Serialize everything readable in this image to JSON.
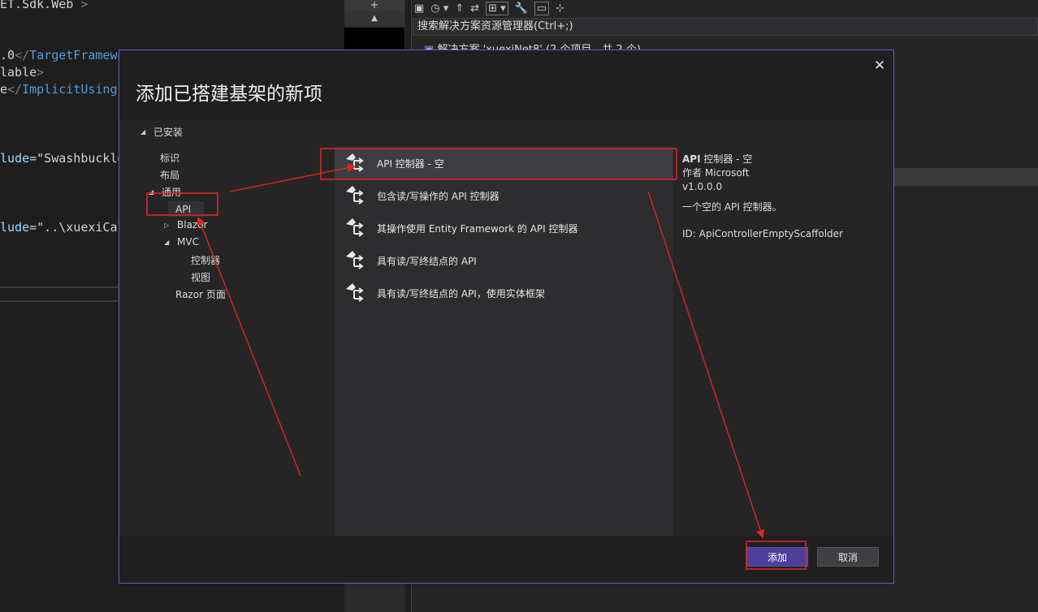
{
  "editor": {
    "lines": [
      {
        "prefix": "",
        "seg": [
          {
            "t": "ET.Sdk.Web",
            "c": "c-text"
          },
          {
            "t": " >",
            "c": "c-gray"
          }
        ]
      },
      {
        "prefix": "",
        "seg": [
          {
            "t": ".0",
            "c": "c-text"
          },
          {
            "t": "</",
            "c": "c-gray"
          },
          {
            "t": "TargetFramewo",
            "c": "c-blue"
          }
        ]
      },
      {
        "prefix": "",
        "seg": [
          {
            "t": "lable",
            "c": "c-text"
          },
          {
            "t": ">",
            "c": "c-gray"
          }
        ]
      },
      {
        "prefix": "",
        "seg": [
          {
            "t": "e",
            "c": "c-text"
          },
          {
            "t": "</",
            "c": "c-gray"
          },
          {
            "t": "ImplicitUsings",
            "c": "c-blue"
          }
        ]
      },
      {
        "prefix": "",
        "seg": [
          {
            "t": "lude",
            "c": "c-attr"
          },
          {
            "t": "=\"Swashbuckle",
            "c": "c-text"
          }
        ]
      },
      {
        "prefix": "",
        "seg": [
          {
            "t": "lude",
            "c": "c-attr"
          },
          {
            "t": "=\"..\\xuexiCal",
            "c": "c-text"
          }
        ]
      }
    ]
  },
  "minimap": {
    "up_glyph": "+",
    "up2_glyph": "▲"
  },
  "solution_explorer": {
    "search_placeholder": "搜索解决方案资源管理器(Ctrl+;)",
    "root_label": "解决方案 'xuexiNet8' (2 个项目，共 2 个)"
  },
  "dialog": {
    "title": "添加已搭建基架的新项",
    "close_glyph": "✕",
    "tree": {
      "installed": "已安装",
      "items": [
        {
          "label": "标识",
          "level": 1,
          "arrow": ""
        },
        {
          "label": "布局",
          "level": 1,
          "arrow": ""
        },
        {
          "label": "通用",
          "level": 1,
          "arrow": "▲"
        },
        {
          "label": "API",
          "level": 2,
          "arrow": ""
        },
        {
          "label": "Blazor",
          "level": 2,
          "arrow": "▷"
        },
        {
          "label": "MVC",
          "level": 2,
          "arrow": "◢"
        },
        {
          "label": "控制器",
          "level": 3,
          "arrow": ""
        },
        {
          "label": "视图",
          "level": 3,
          "arrow": ""
        },
        {
          "label": "Razor 页面",
          "level": 2,
          "arrow": ""
        }
      ]
    },
    "list": [
      {
        "label": "API 控制器 - 空"
      },
      {
        "label": "包含读/写操作的 API 控制器"
      },
      {
        "label": "其操作使用 Entity Framework 的 API 控制器"
      },
      {
        "label": "具有读/写终结点的 API"
      },
      {
        "label": "具有读/写终结点的 API，使用实体框架"
      }
    ],
    "details": {
      "name_bold": "API",
      "name_rest": " 控制器 - 空",
      "author": "作者 Microsoft",
      "version": "v1.0.0.0",
      "description": "一个空的 API 控制器。",
      "id": "ID: ApiControllerEmptyScaffolder"
    },
    "buttons": {
      "add": "添加",
      "cancel": "取消"
    }
  },
  "colors": {
    "accent": "#6b59c9",
    "annotation": "#e8261e",
    "add_button": "#4b3f99"
  }
}
